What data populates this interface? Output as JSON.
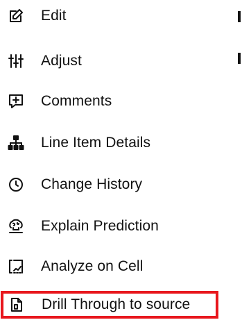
{
  "menu": {
    "items": [
      {
        "label": "Edit",
        "icon": "edit-icon"
      },
      {
        "label": "Adjust",
        "icon": "sliders-icon"
      },
      {
        "label": "Comments",
        "icon": "comment-plus-icon"
      },
      {
        "label": "Line Item Details",
        "icon": "hierarchy-icon"
      },
      {
        "label": "Change History",
        "icon": "clock-icon"
      },
      {
        "label": "Explain Prediction",
        "icon": "brain-icon"
      },
      {
        "label": "Analyze on Cell",
        "icon": "analyze-icon"
      },
      {
        "label": "Drill Through to source",
        "icon": "drill-through-icon"
      }
    ]
  },
  "colors": {
    "highlight_border": "#e8171d",
    "text": "#111111",
    "background": "#ffffff"
  }
}
